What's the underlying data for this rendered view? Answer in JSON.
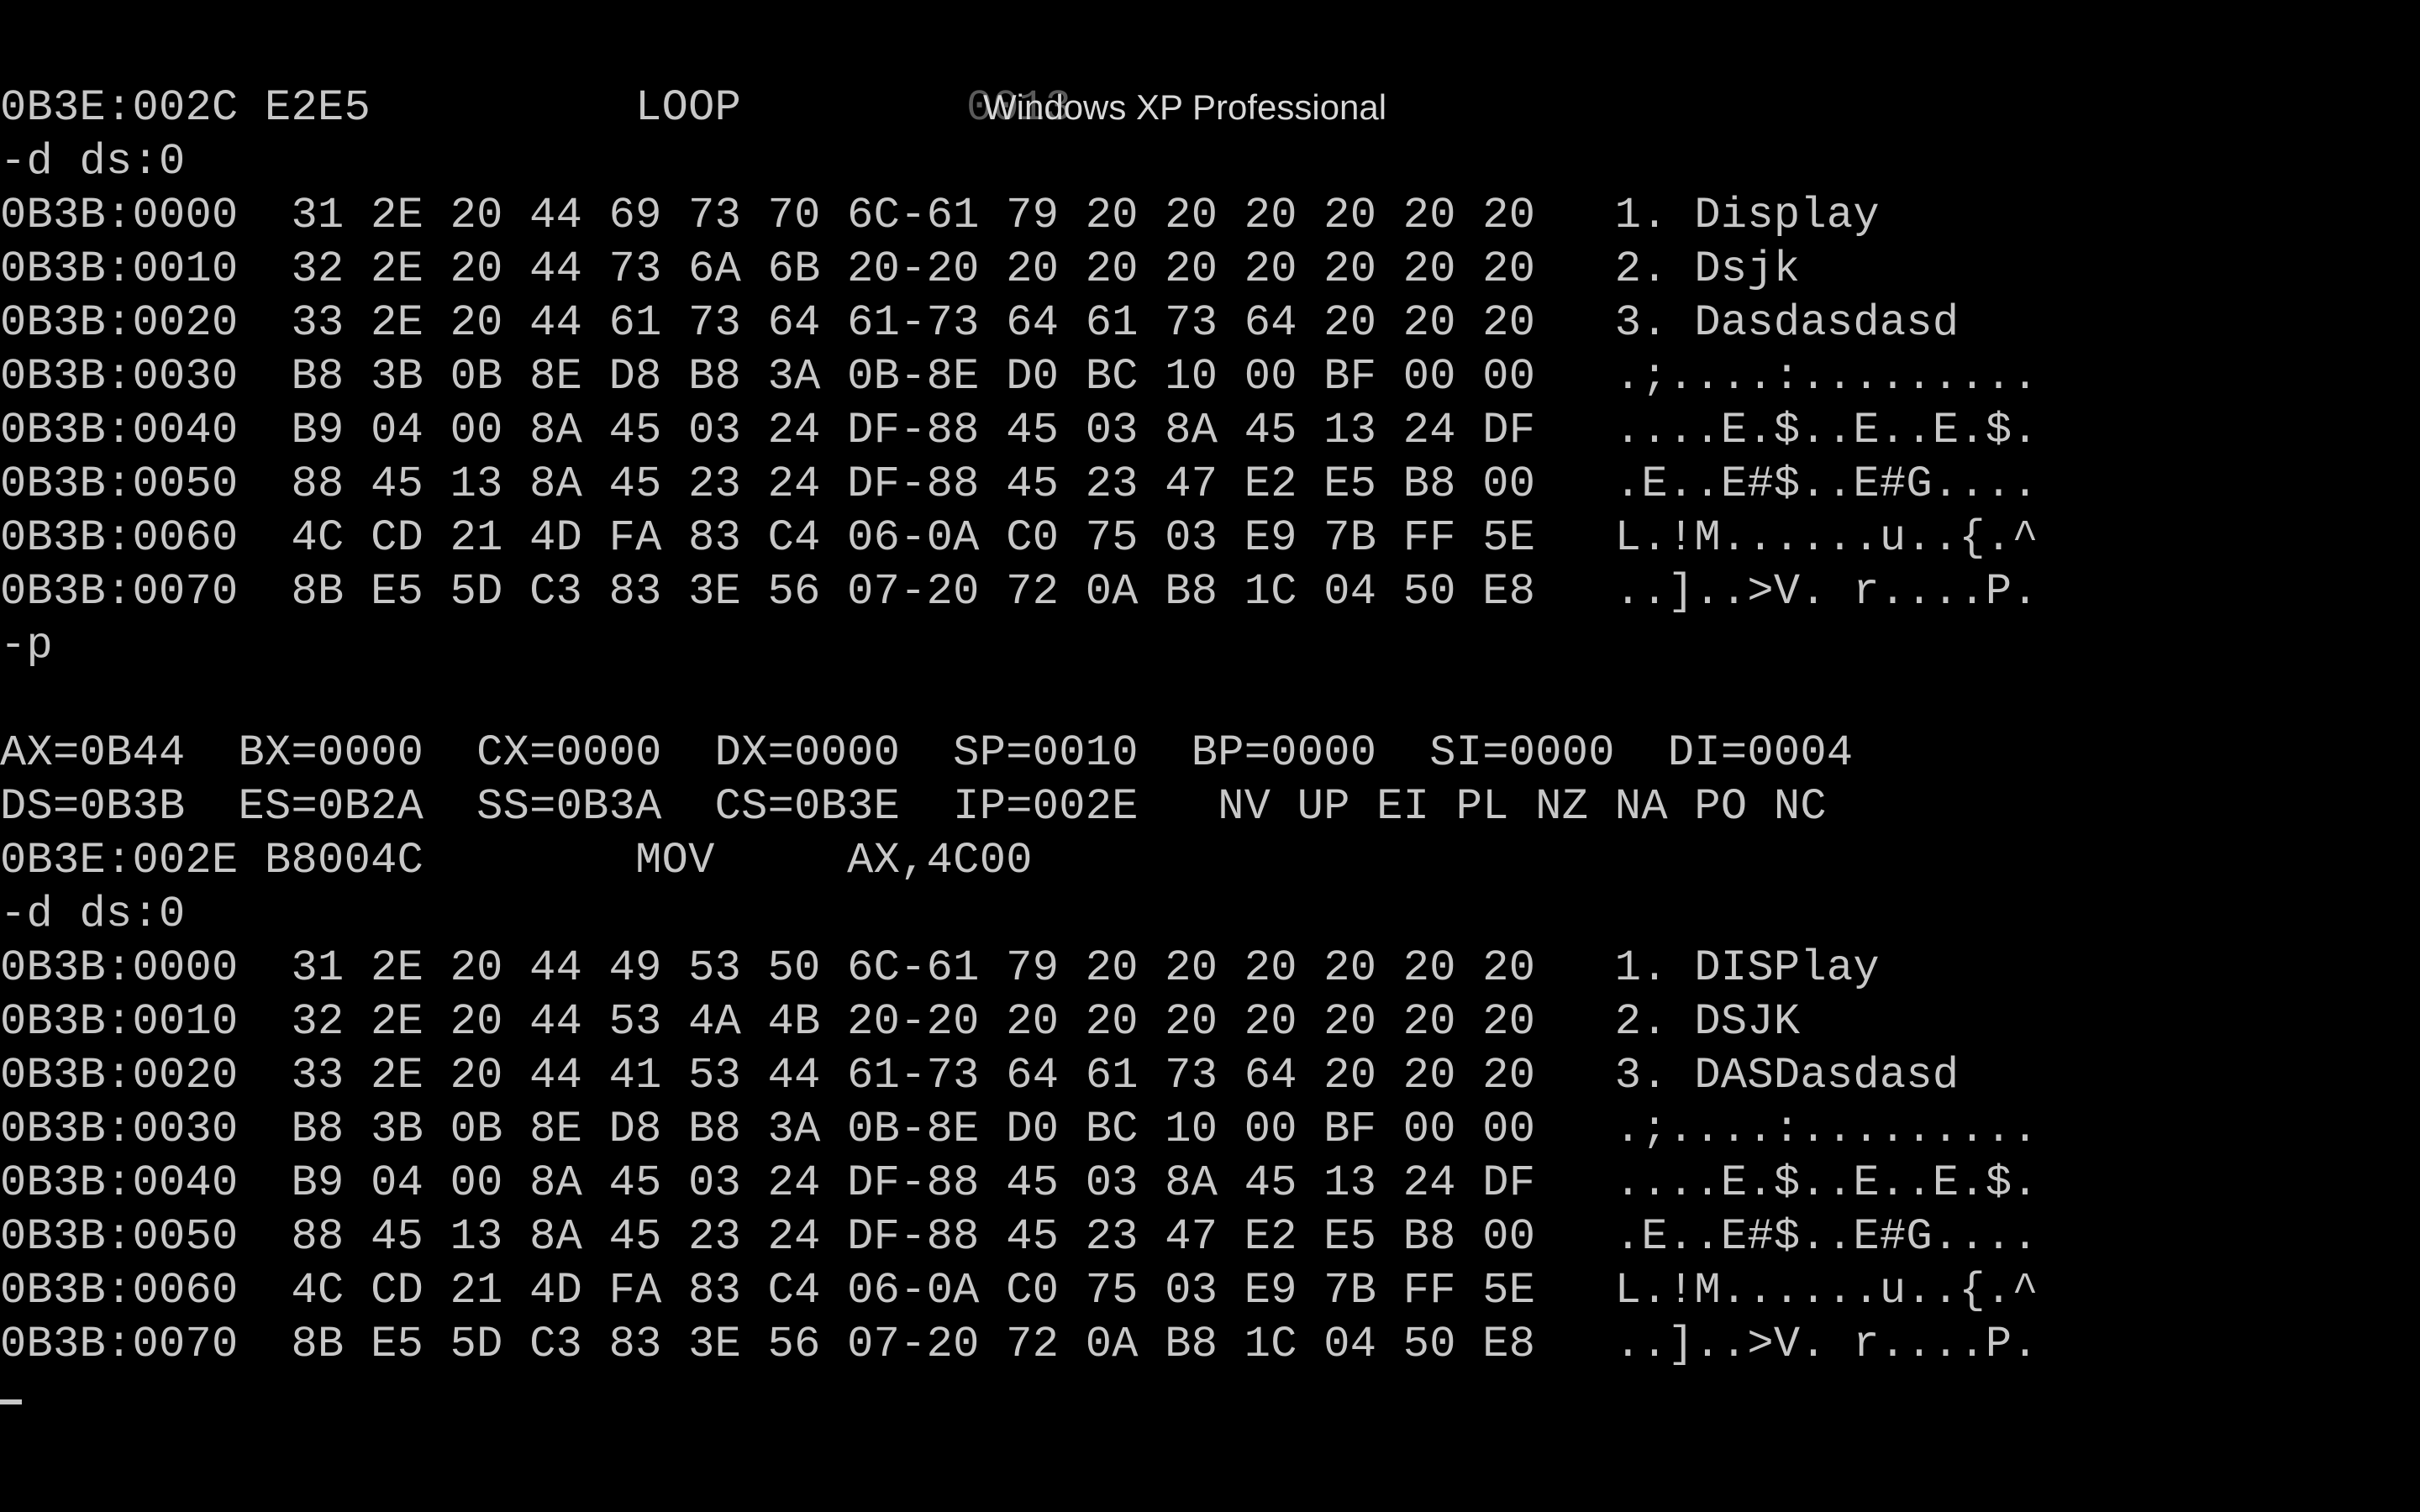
{
  "window": {
    "title": "Windows XP Professional",
    "title_ghost_text": "0013"
  },
  "console": {
    "text_color": "#c7c7c7",
    "background": "#000000",
    "lines": [
      "0B3E:002C E2E5          LOOP    ",
      "-d ds:0",
      "0B3B:0000  31 2E 20 44 69 73 70 6C-61 79 20 20 20 20 20 20   1. Display",
      "0B3B:0010  32 2E 20 44 73 6A 6B 20-20 20 20 20 20 20 20 20   2. Dsjk",
      "0B3B:0020  33 2E 20 44 61 73 64 61-73 64 61 73 64 20 20 20   3. Dasdasdasd",
      "0B3B:0030  B8 3B 0B 8E D8 B8 3A 0B-8E D0 BC 10 00 BF 00 00   .;....:.........",
      "0B3B:0040  B9 04 00 8A 45 03 24 DF-88 45 03 8A 45 13 24 DF   ....E.$..E..E.$.",
      "0B3B:0050  88 45 13 8A 45 23 24 DF-88 45 23 47 E2 E5 B8 00   .E..E#$..E#G....",
      "0B3B:0060  4C CD 21 4D FA 83 C4 06-0A C0 75 03 E9 7B FF 5E   L.!M......u..{.^",
      "0B3B:0070  8B E5 5D C3 83 3E 56 07-20 72 0A B8 1C 04 50 E8   ..]..>V. r....P.",
      "-p",
      "",
      "AX=0B44  BX=0000  CX=0000  DX=0000  SP=0010  BP=0000  SI=0000  DI=0004",
      "DS=0B3B  ES=0B2A  SS=0B3A  CS=0B3E  IP=002E   NV UP EI PL NZ NA PO NC",
      "0B3E:002E B8004C        MOV     AX,4C00",
      "-d ds:0",
      "0B3B:0000  31 2E 20 44 49 53 50 6C-61 79 20 20 20 20 20 20   1. DISPlay",
      "0B3B:0010  32 2E 20 44 53 4A 4B 20-20 20 20 20 20 20 20 20   2. DSJK",
      "0B3B:0020  33 2E 20 44 41 53 44 61-73 64 61 73 64 20 20 20   3. DASDasdasd",
      "0B3B:0030  B8 3B 0B 8E D8 B8 3A 0B-8E D0 BC 10 00 BF 00 00   .;....:.........",
      "0B3B:0040  B9 04 00 8A 45 03 24 DF-88 45 03 8A 45 13 24 DF   ....E.$..E..E.$.",
      "0B3B:0050  88 45 13 8A 45 23 24 DF-88 45 23 47 E2 E5 B8 00   .E..E#$..E#G....",
      "0B3B:0060  4C CD 21 4D FA 83 C4 06-0A C0 75 03 E9 7B FF 5E   L.!M......u..{.^",
      "0B3B:0070  8B E5 5D C3 83 3E 56 07-20 72 0A B8 1C 04 50 E8   ..]..>V. r....P."
    ]
  }
}
